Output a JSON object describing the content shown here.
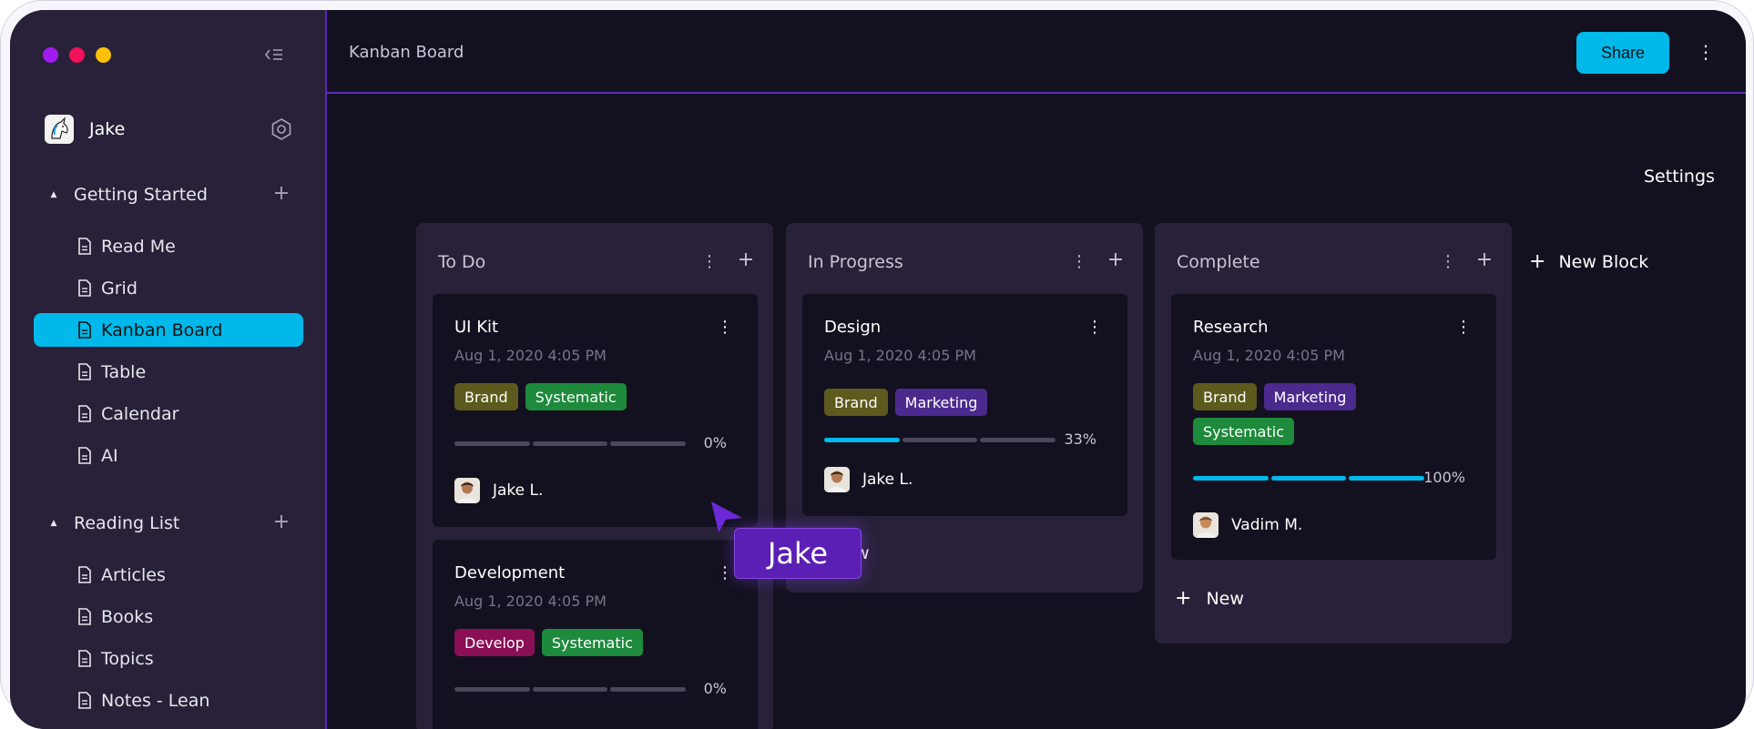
{
  "sidebar": {
    "traffic_colors": [
      "#a11cf0",
      "#f0125a",
      "#ffc107"
    ],
    "user": {
      "name": "Jake"
    },
    "sections": [
      {
        "title": "Getting Started",
        "items": [
          "Read Me",
          "Grid",
          "Kanban Board",
          "Table",
          "Calendar",
          "AI"
        ]
      },
      {
        "title": "Reading List",
        "items": [
          "Articles",
          "Books",
          "Topics",
          "Notes - Lean"
        ]
      }
    ],
    "active_item": "Kanban Board"
  },
  "header": {
    "title": "Kanban Board",
    "share_label": "Share"
  },
  "settings_label": "Settings",
  "new_block_label": "New Block",
  "new_label": "New",
  "columns": [
    {
      "title": "To Do",
      "cards": [
        {
          "title": "UI Kit",
          "date": "Aug 1, 2020 4:05 PM",
          "tags": [
            "Brand",
            "Systematic"
          ],
          "progress_segments_filled": 0,
          "progress_segments_total": 3,
          "progress_label": "0%",
          "assignee": "Jake L."
        },
        {
          "title": "Development",
          "date": "Aug 1, 2020 4:05 PM",
          "tags": [
            "Develop",
            "Systematic"
          ],
          "progress_segments_filled": 0,
          "progress_segments_total": 3,
          "progress_label": "0%"
        }
      ]
    },
    {
      "title": "In Progress",
      "cards": [
        {
          "title": "Design",
          "date": "Aug 1, 2020 4:05 PM",
          "tags": [
            "Brand",
            "Marketing"
          ],
          "progress_segments_filled": 1,
          "progress_segments_total": 3,
          "progress_label": "33%",
          "assignee": "Jake L."
        }
      ],
      "new_label_partial": "w"
    },
    {
      "title": "Complete",
      "cards": [
        {
          "title": "Research",
          "date": "Aug 1, 2020 4:05 PM",
          "tags": [
            "Brand",
            "Marketing",
            "Systematic"
          ],
          "progress_segments_filled": 3,
          "progress_segments_total": 3,
          "progress_label": "100%",
          "assignee": "Vadim M."
        }
      ],
      "new_label": "New"
    }
  ],
  "tag_colors": {
    "Brand": "#5c5a1c",
    "Systematic": "#1d8a3c",
    "Marketing": "#4b2a8e",
    "Develop": "#8a0f55"
  },
  "cursor": {
    "label": "Jake",
    "color": "#5b1fb5"
  },
  "accent": "#00b8ea"
}
